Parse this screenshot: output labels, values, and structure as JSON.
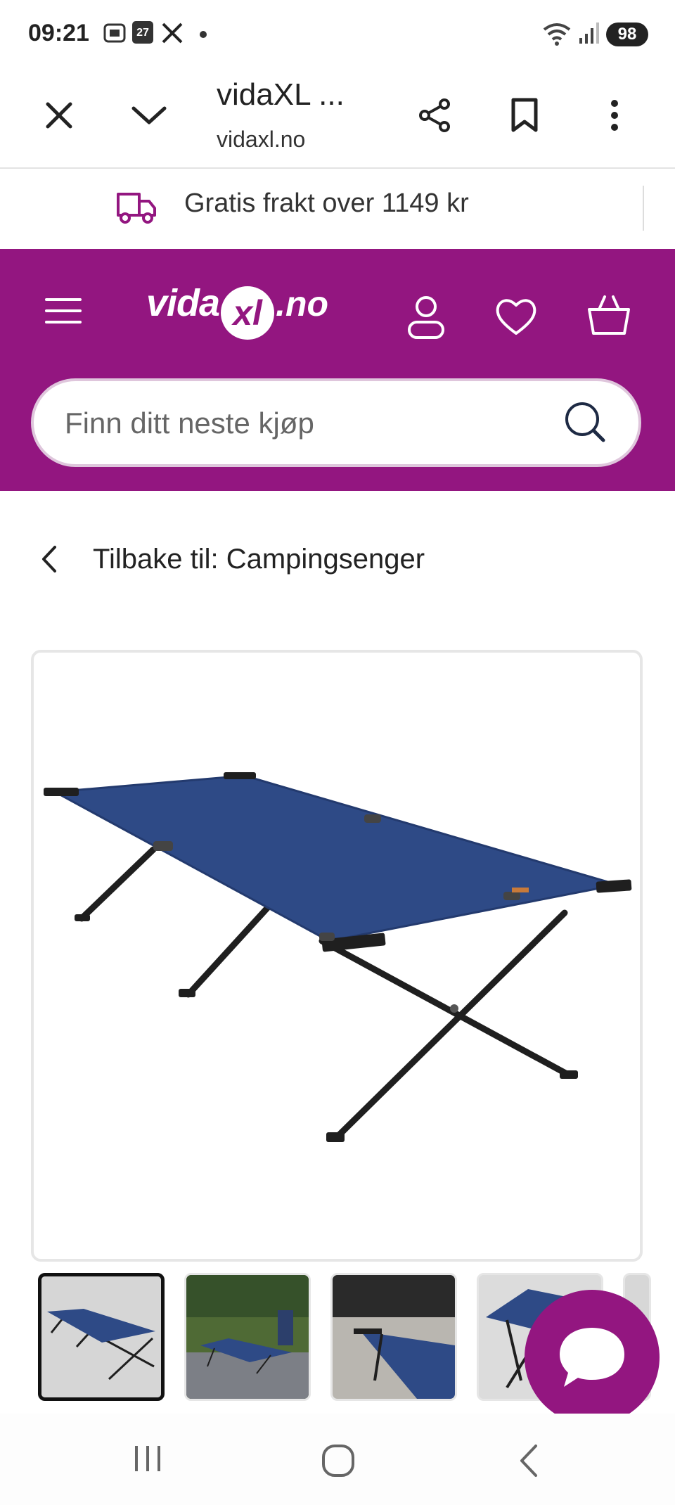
{
  "status_bar": {
    "time": "09:21",
    "battery": "98",
    "calendar_day": "27"
  },
  "browser": {
    "title": "vidaXL ...",
    "url": "vidaxl.no"
  },
  "banner": {
    "text": "Gratis frakt over 1149 kr"
  },
  "header": {
    "logo_part1": "vida",
    "logo_part2": "xl",
    "logo_part3": ".no",
    "search_placeholder": "Finn ditt neste kjøp"
  },
  "breadcrumb": {
    "back_label": "Tilbake til: Campingsenger"
  },
  "product": {
    "image_alt": "Camping bed",
    "thumbnails": [
      "thumb-1",
      "thumb-2",
      "thumb-3",
      "thumb-4"
    ]
  },
  "colors": {
    "brand": "#931680",
    "bed_fabric": "#2e4a86",
    "frame": "#1f1f1f"
  }
}
